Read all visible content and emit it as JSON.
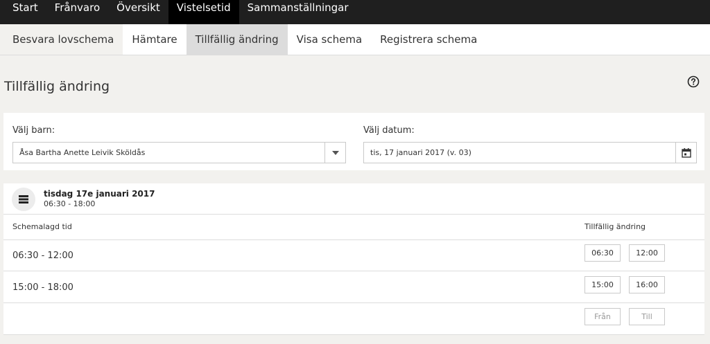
{
  "topnav": {
    "items": [
      "Start",
      "Frånvaro",
      "Översikt",
      "Vistelsetid",
      "Sammanställningar"
    ],
    "active_index": 3
  },
  "subnav": {
    "items": [
      "Besvara lovschema",
      "Hämtare",
      "Tillfällig ändring",
      "Visa schema",
      "Registrera schema"
    ],
    "active_index": 2
  },
  "page": {
    "title": "Tillfällig ändring",
    "help_icon": "question-circle-icon"
  },
  "selection": {
    "child_label": "Välj barn:",
    "child_value": "Åsa Bartha Anette Leivik Sköldås",
    "child_dropdown_icon": "caret-down-icon",
    "date_label": "Välj datum:",
    "date_value": "tis, 17 januari 2017 (v. 03)",
    "date_icon": "calendar-icon"
  },
  "schedule": {
    "day_icon": "list-icon",
    "day_title": "tisdag 17e januari 2017",
    "day_range": "06:30 - 18:00",
    "col_scheduled": "Schemalagd tid",
    "col_change": "Tillfällig ändring",
    "rows": [
      {
        "time": "06:30 - 12:00",
        "from": "06:30",
        "to": "12:00"
      },
      {
        "time": "15:00 - 18:00",
        "from": "15:00",
        "to": "16:00"
      }
    ],
    "new_row": {
      "from_placeholder": "Från",
      "to_placeholder": "Till"
    }
  },
  "colors": {
    "topnav_bg": "#1f1f1f",
    "topnav_active": "#000000",
    "subnav_active": "#dcdcdc",
    "page_bg": "#f2f1ee"
  }
}
